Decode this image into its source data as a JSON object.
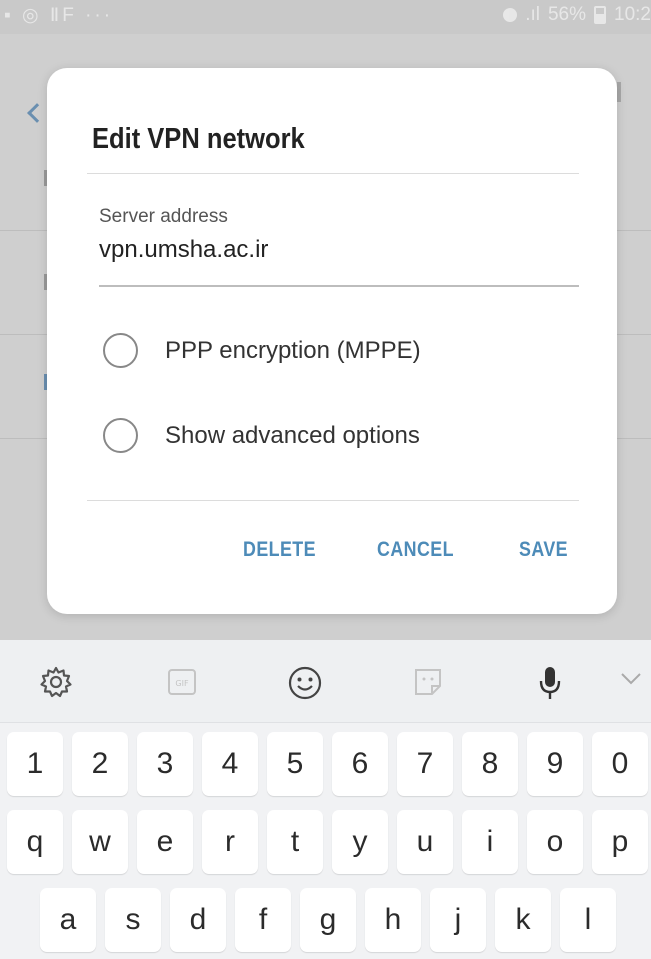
{
  "status_bar": {
    "left_text": "▪ ◎ ⅡF ···",
    "battery": "56%",
    "time": "10:2"
  },
  "dialog": {
    "title": "Edit VPN network",
    "server_address_label": "Server address",
    "server_address_value": "vpn.umsha.ac.ir",
    "options": [
      {
        "label": "PPP encryption (MPPE)",
        "checked": false
      },
      {
        "label": "Show advanced options",
        "checked": false
      }
    ],
    "buttons": {
      "delete": "DELETE",
      "cancel": "CANCEL",
      "save": "SAVE"
    },
    "accent_color": "#4d8bb8"
  },
  "keyboard": {
    "toolbar_icons": [
      "settings-icon",
      "gif-icon",
      "emoji-icon",
      "sticker-icon",
      "microphone-icon",
      "collapse-icon"
    ],
    "rows": [
      [
        "1",
        "2",
        "3",
        "4",
        "5",
        "6",
        "7",
        "8",
        "9",
        "0"
      ],
      [
        "q",
        "w",
        "e",
        "r",
        "t",
        "y",
        "u",
        "i",
        "o",
        "p"
      ],
      [
        "a",
        "s",
        "d",
        "f",
        "g",
        "h",
        "j",
        "k",
        "l"
      ]
    ]
  }
}
